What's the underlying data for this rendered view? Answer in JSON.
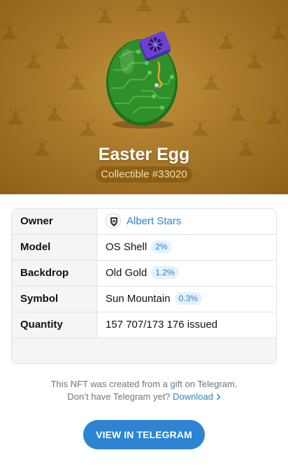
{
  "hero": {
    "title": "Easter Egg",
    "badge": "Collectible #33020",
    "backdrop_color": "#a9792a",
    "pattern_icon": "sun-mountain-icon"
  },
  "attributes": [
    {
      "label": "Owner",
      "value": "Albert Stars",
      "percent": "",
      "avatar_icon": "shield-crest-icon"
    },
    {
      "label": "Model",
      "value": "OS Shell",
      "percent": "2%"
    },
    {
      "label": "Backdrop",
      "value": "Old Gold",
      "percent": "1.2%"
    },
    {
      "label": "Symbol",
      "value": "Sun Mountain",
      "percent": "0.3%"
    },
    {
      "label": "Quantity",
      "value": "157 707/173 176 issued",
      "percent": ""
    }
  ],
  "note": {
    "line1": "This NFT was created from a gift on Telegram.",
    "line2": "Don’t have Telegram yet?",
    "download_link": "Download",
    "chevron_icon": "chevron-right-icon"
  },
  "cta_button": "VIEW IN TELEGRAM",
  "colors": {
    "accent": "#2c84d3",
    "link": "#2a84d2",
    "egg_green": "#2f8f2a"
  }
}
